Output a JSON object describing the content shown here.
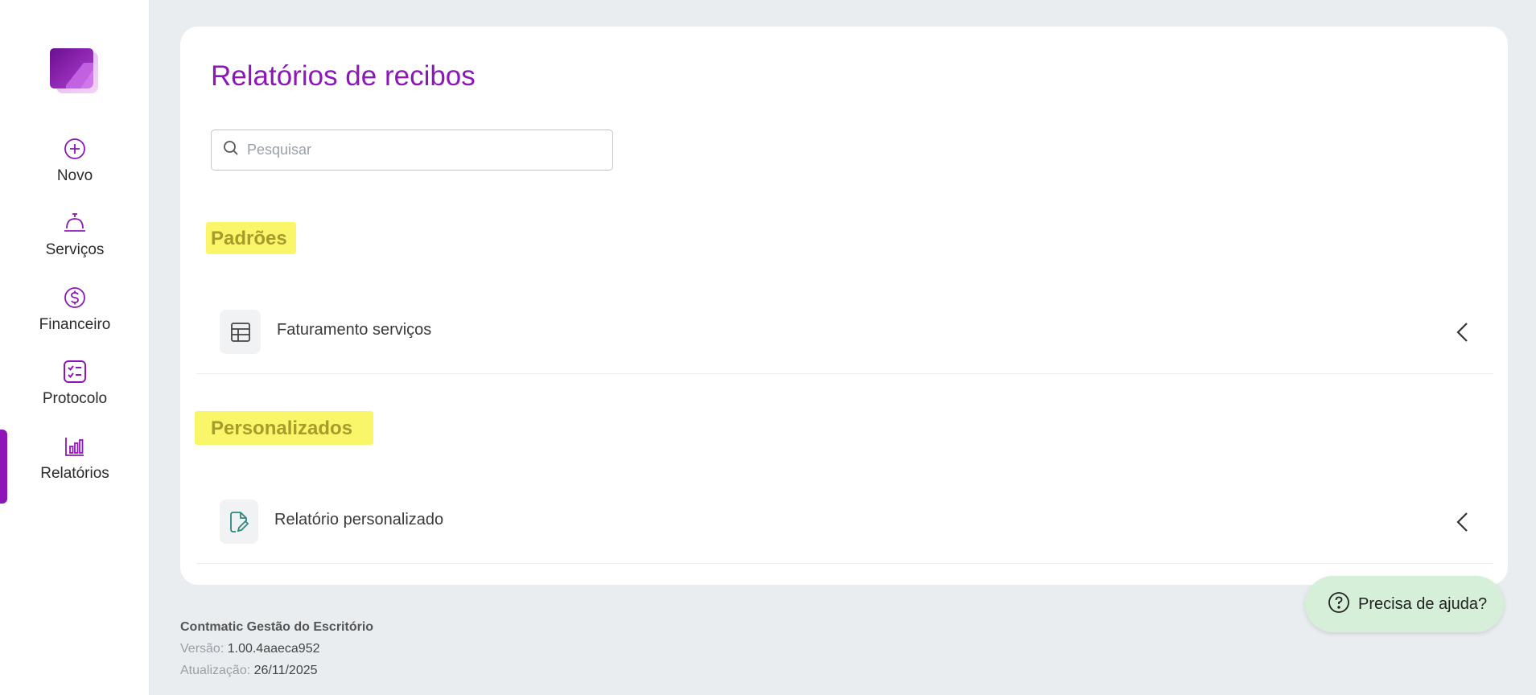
{
  "sidebar": {
    "logo_icon": "app-logo",
    "items": [
      {
        "label": "Novo",
        "icon": "plus-circle-icon"
      },
      {
        "label": "Serviços",
        "icon": "service-bell-icon"
      },
      {
        "label": "Financeiro",
        "icon": "dollar-circle-icon"
      },
      {
        "label": "Protocolo",
        "icon": "checklist-icon"
      },
      {
        "label": "Relatórios",
        "icon": "bar-chart-icon",
        "active": true
      }
    ],
    "accent_color": "#8e16b8"
  },
  "main": {
    "title": "Relatórios de recibos",
    "search": {
      "placeholder": "Pesquisar",
      "value": ""
    },
    "sections": [
      {
        "title": "Padrões",
        "items": [
          {
            "label": "Faturamento serviços",
            "icon": "table-icon"
          }
        ]
      },
      {
        "title": "Personalizados",
        "items": [
          {
            "label": "Relatório personalizado",
            "icon": "file-edit-icon"
          }
        ]
      }
    ]
  },
  "footer": {
    "product": "Contmatic Gestão do Escritório",
    "version_label": "Versão:",
    "version_value": "1.00.4aaeca952",
    "update_label": "Atualização:",
    "update_value": "26/11/2025"
  },
  "help": {
    "label": "Precisa de ajuda?",
    "icon": "question-circle-icon"
  },
  "colors": {
    "accent": "#8e16b8",
    "section_title": "#a79b2b",
    "highlight": "#f9f66a",
    "help_bg": "#d6efd9",
    "page_bg": "#e9edf0"
  }
}
